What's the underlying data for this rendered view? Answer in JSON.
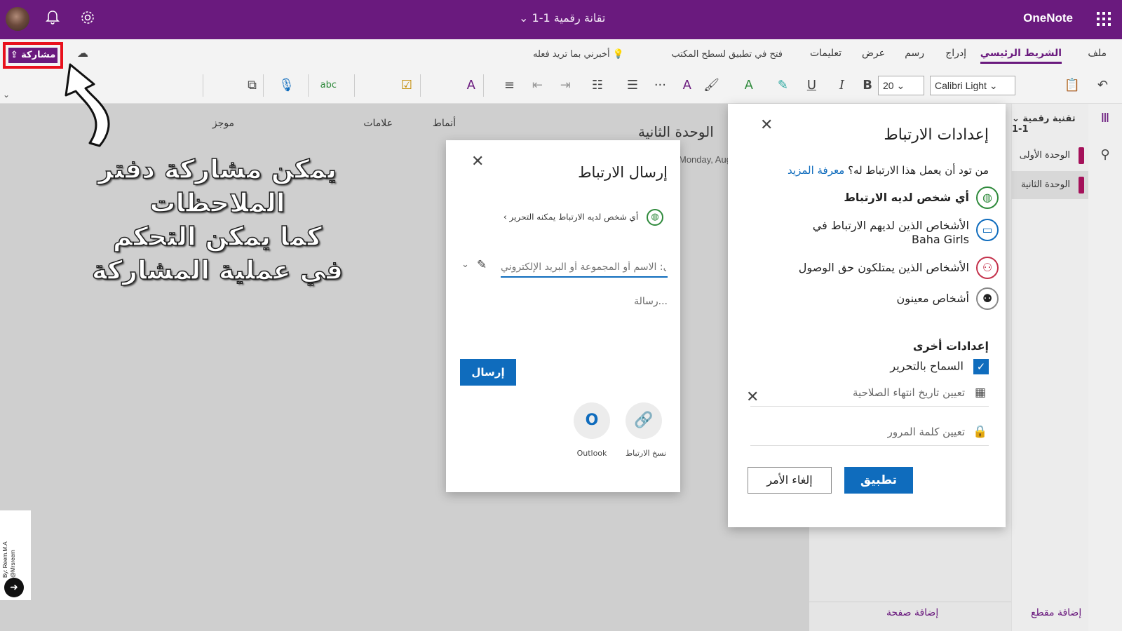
{
  "titlebar": {
    "doc_title": "تقانة رقمية 1-1",
    "app_name": "OneNote",
    "avatar": "avatar",
    "icons": {
      "bell": "bell-icon",
      "gear": "gear-icon",
      "waffle": "waffle-icon"
    }
  },
  "ribbon": {
    "tabs": [
      {
        "label": "ملف"
      },
      {
        "label": "الشريط الرئيسي",
        "active": true
      },
      {
        "label": "إدراج"
      },
      {
        "label": "رسم"
      },
      {
        "label": "عرض"
      },
      {
        "label": "تعليمات"
      }
    ],
    "open_desktop": "فتح في تطبيق لسطح المكتب",
    "tell_me": "أخبرني بما تريد فعله",
    "share_label": "مشاركة",
    "font_name": "Calibri Light",
    "font_size": "20",
    "styles_label": "أنماط",
    "tags_label": "علامات",
    "summary_label": "موجز",
    "more": "···"
  },
  "sections_panel": {
    "notebook_title": "تقنية رقمية 1-1",
    "sections": [
      {
        "label": "الوحدة الأولى"
      },
      {
        "label": "الوحدة الثانية",
        "selected": true
      }
    ],
    "add_section": "إضافة مقطع",
    "add_page": "إضافة صفحة"
  },
  "page": {
    "title_partial": "الوحدة الثانية",
    "date_partial": "Monday, Aug"
  },
  "link_settings": {
    "title": "إعدادات الارتباط",
    "question": "من تود أن يعمل هذا الارتباط له؟",
    "learn_more": "معرفة المزيد",
    "options": [
      {
        "label": "أي شخص لديه الارتباط",
        "icon": "globe-icon",
        "color": "#2f8a3c",
        "selected": true
      },
      {
        "label": "الأشخاص الذين لديهم الارتباط في",
        "sub": "Baha Girls",
        "icon": "briefcase-icon",
        "color": "#0f6cbd"
      },
      {
        "label": "الأشخاص الذين يمتلكون حق الوصول",
        "icon": "people-check-icon",
        "color": "#c4314b"
      },
      {
        "label": "أشخاص معينون",
        "icon": "people-icon",
        "color": "#555555"
      }
    ],
    "other_settings": "إعدادات أخرى",
    "allow_edit": "السماح بالتحرير",
    "allow_edit_checked": true,
    "expiry_placeholder": "تعيين تاريخ انتهاء الصلاحية",
    "password_placeholder": "تعيين كلمة المرور",
    "apply": "تطبيق",
    "cancel": "إلغاء الأمر"
  },
  "send_link": {
    "title": "إرسال الارتباط",
    "permission": "أي شخص لديه الارتباط يمكنه التحرير",
    "to_placeholder": "إلى: الاسم أو المجموعة أو البريد الإلكتروني",
    "message_placeholder": "رسالة...",
    "send": "إرسال",
    "copy_link": "نسخ الارتباط",
    "outlook": "Outlook"
  },
  "annotation": {
    "line1": "يمكن مشاركة دفتر الملاحظات",
    "line2": "كما يمكن التحكم",
    "line3": "في عملية المشاركة"
  },
  "credit": {
    "by": "By: Reem.M.A",
    "handle": "@Mrsreem"
  },
  "colors": {
    "brand": "#6a1a7e",
    "accent": "#0f6cbd",
    "highlight_box": "#e8101c",
    "section_tab": "#a4115a"
  }
}
